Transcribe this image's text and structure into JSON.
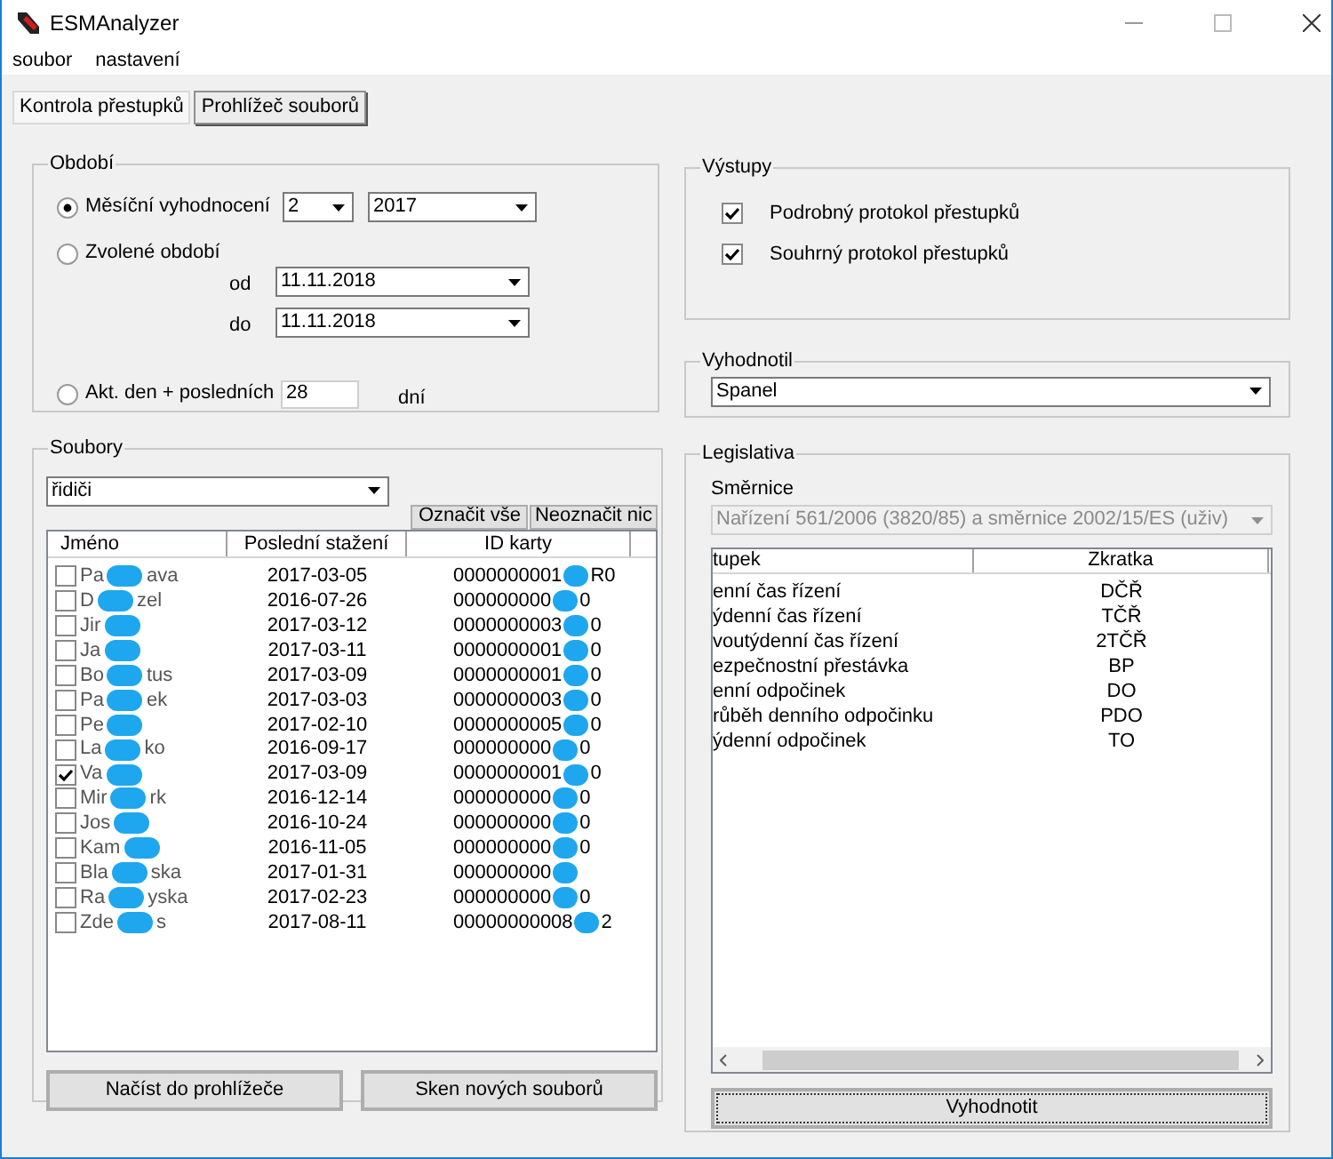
{
  "window": {
    "title": "ESMAnalyzer"
  },
  "menu": [
    "soubor",
    "nastavení"
  ],
  "tabs": [
    {
      "label": "Kontrola přestupků",
      "selected": true
    },
    {
      "label": "Prohlížeč souborů",
      "selected": false
    }
  ],
  "period": {
    "title": "Období",
    "options": [
      {
        "label": "Měsíční vyhodnocení",
        "selected": true
      },
      {
        "label": "Zvolené období",
        "selected": false
      },
      {
        "label": "Akt. den + posledních",
        "selected": false
      }
    ],
    "month": "2",
    "year": "2017",
    "from_label": "od",
    "from": "11.11.2018",
    "to_label": "do",
    "to": "11.11.2018",
    "days": "28",
    "days_unit": "dní"
  },
  "outputs": {
    "title": "Výstupy",
    "items": [
      {
        "label": "Podrobný protokol přestupků",
        "checked": true
      },
      {
        "label": "Souhrný protokol přestupků",
        "checked": true
      }
    ]
  },
  "evaluator": {
    "title": "Vyhodnotil",
    "value": "Spanel"
  },
  "files": {
    "title": "Soubory",
    "filter": "řidiči",
    "select_all": "Označit vše",
    "select_none": "Neoznačit nic",
    "columns": [
      "Jméno",
      "Poslední stažení",
      "ID karty"
    ],
    "rows": [
      {
        "name_start": "Pa",
        "name_end": "ava",
        "date": "2017-03-05",
        "id_start": "0000000001",
        "id_end": "R0",
        "checked": false
      },
      {
        "name_start": "D",
        "name_end": "zel",
        "date": "2016-07-26",
        "id_start": "000000000",
        "id_end": "0",
        "checked": false
      },
      {
        "name_start": "Jir",
        "name_end": "",
        "date": "2017-03-12",
        "id_start": "0000000003",
        "id_end": "0",
        "checked": false
      },
      {
        "name_start": "Ja",
        "name_end": "",
        "date": "2017-03-11",
        "id_start": "0000000001",
        "id_end": "0",
        "checked": false
      },
      {
        "name_start": "Bo",
        "name_end": "tus",
        "date": "2017-03-09",
        "id_start": "0000000001",
        "id_end": "0",
        "checked": false
      },
      {
        "name_start": "Pa",
        "name_end": "ek",
        "date": "2017-03-03",
        "id_start": "0000000003",
        "id_end": "0",
        "checked": false
      },
      {
        "name_start": "Pe",
        "name_end": "",
        "date": "2017-02-10",
        "id_start": "0000000005",
        "id_end": "0",
        "checked": false
      },
      {
        "name_start": "La",
        "name_end": "ko",
        "date": "2016-09-17",
        "id_start": "000000000",
        "id_end": "0",
        "checked": false
      },
      {
        "name_start": "Va",
        "name_end": "",
        "date": "2017-03-09",
        "id_start": "0000000001",
        "id_end": "0",
        "checked": true
      },
      {
        "name_start": "Mir",
        "name_end": "rk",
        "date": "2016-12-14",
        "id_start": "000000000",
        "id_end": "0",
        "checked": false
      },
      {
        "name_start": "Jos",
        "name_end": "",
        "date": "2016-10-24",
        "id_start": "000000000",
        "id_end": "0",
        "checked": false
      },
      {
        "name_start": "Kam",
        "name_end": "",
        "date": "2016-11-05",
        "id_start": "000000000",
        "id_end": "0",
        "checked": false
      },
      {
        "name_start": "Bla",
        "name_end": "ska",
        "date": "2017-01-31",
        "id_start": "000000000",
        "id_end": "",
        "checked": false
      },
      {
        "name_start": "Ra",
        "name_end": "yska",
        "date": "2017-02-23",
        "id_start": "000000000",
        "id_end": "0",
        "checked": false
      },
      {
        "name_start": "Zde",
        "name_end": "s",
        "date": "2017-08-11",
        "id_start": "00000000008",
        "id_end": "2",
        "checked": false
      }
    ],
    "buttons": [
      "Načíst do prohlížeče",
      "Sken nových souborů"
    ]
  },
  "legislation": {
    "title": "Legislativa",
    "directive_label": "Směrnice",
    "directive": "Nařízení 561/2006 (3820/85) a směrnice 2002/15/ES (uživ)",
    "columns": [
      "tupek",
      "Zkratka"
    ],
    "rows": [
      {
        "name": "enní čas řízení",
        "code": "DČŘ"
      },
      {
        "name": "ýdenní čas řízení",
        "code": "TČŘ"
      },
      {
        "name": "voutýdenní čas řízení",
        "code": "2TČŘ"
      },
      {
        "name": "ezpečnostní přestávka",
        "code": "BP"
      },
      {
        "name": "enní odpočinek",
        "code": "DO"
      },
      {
        "name": "růběh denního odpočinku",
        "code": "PDO"
      },
      {
        "name": "ýdenní odpočinek",
        "code": "TO"
      }
    ],
    "button": "Vyhodnotit"
  }
}
